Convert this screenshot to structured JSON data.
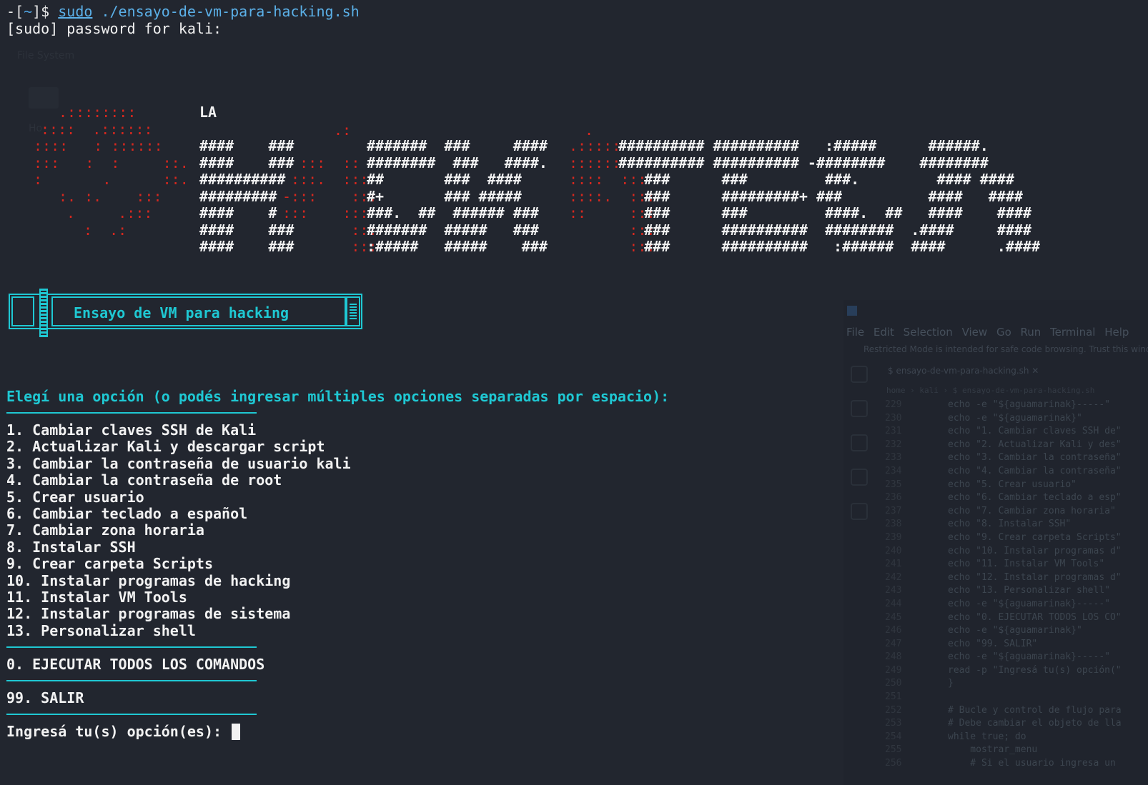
{
  "terminal": {
    "prompt_prefix": "-[",
    "prompt_dir": "~",
    "prompt_suffix": "]$ ",
    "command": "sudo",
    "argument": " ./ensayo-de-vm-para-hacking.sh",
    "sudo_line": "[sudo] password for kali:"
  },
  "banner": {
    "la": "LA",
    "dots_top": ".:",
    "dot_single": ".",
    "skull_lines": [
      ".::::::::",
      "::::  .::::::",
      "::::   : ::::::",
      ":::   :  :     ::.",
      ":       .      ::.",
      ":. :.    :::",
      ".     .:::",
      ":  .:"
    ],
    "white_col1": [
      "####    ###",
      "####    ###",
      "##########",
      "#########",
      "####    #",
      "####    ###",
      "####    ###"
    ],
    "red_col1": [
      "",
      "  :::  ::",
      " :::.  :::",
      "-:::    :::",
      ":::    :::",
      "        :::",
      "        :::"
    ],
    "mid_1": [
      "#######  ###     ####",
      "########  ###   ####.",
      "##       ###  ####",
      "#+       ### #####",
      "###.  ##  ###### ###",
      "#######  #####   ###",
      ":#####   #####    ###"
    ],
    "red_col2": [
      ".:::::",
      "::::::",
      "::::  :::",
      "::::.  :::",
      "::     :::",
      "       :::",
      "       :::"
    ],
    "right_1": [
      "########## ##########   :#####      ######.",
      "########## ########## -########    ########",
      "   ###      ###         ###.         #### ####",
      "   ###      #########+ ###          ####   ####",
      "   ###      ###         ####.  ##   ####    ####",
      "   ###      ##########  ########  .####     ####",
      "   ###      ##########   :######  ####      .####"
    ]
  },
  "title_box": {
    "label": "Ensayo de VM para hacking"
  },
  "menu": {
    "heading": "Elegí una opción (o podés ingresar múltiples opciones separadas por espacio):",
    "items": [
      "1. Cambiar claves SSH de Kali",
      "2. Actualizar Kali y descargar script",
      "3. Cambiar la contraseña de usuario kali",
      "4. Cambiar la contraseña de root",
      "5. Crear usuario",
      "6. Cambiar teclado a español",
      "7. Cambiar zona horaria",
      "8. Instalar SSH",
      "9. Crear carpeta Scripts",
      "10. Instalar programas de hacking",
      "11. Instalar VM Tools",
      "12. Instalar programas de sistema",
      "13. Personalizar shell"
    ],
    "run_all": "0. EJECUTAR TODOS LOS COMANDOS",
    "exit": "99. SALIR",
    "input_prompt": "Ingresá tu(s) opción(es): "
  },
  "background_window": {
    "faint_label": "File System",
    "faint_home_label": "Ho",
    "menubar": "File Edit Selection View Go Run Terminal Help",
    "notice": "Restricted Mode is intended for safe code browsing. Trust this window",
    "tab": "$ ensayo-de-vm-para-hacking.sh  ✕",
    "breadcrumb": "home › kali › $ ensayo-de-vm-para-hacking.sh",
    "code_lines": [
      {
        "n": "229",
        "t": "echo -e \"${aguamarinak}-----\""
      },
      {
        "n": "230",
        "t": "echo -e \"${aguamarinak}\""
      },
      {
        "n": "231",
        "t": "echo \"1. Cambiar claves SSH de\""
      },
      {
        "n": "232",
        "t": "echo \"2. Actualizar Kali y des\""
      },
      {
        "n": "233",
        "t": "echo \"3. Cambiar la contraseña\""
      },
      {
        "n": "234",
        "t": "echo \"4. Cambiar la contraseña\""
      },
      {
        "n": "235",
        "t": "echo \"5. Crear usuario\""
      },
      {
        "n": "236",
        "t": "echo \"6. Cambiar teclado a esp\""
      },
      {
        "n": "237",
        "t": "echo \"7. Cambiar zona horaria\""
      },
      {
        "n": "238",
        "t": "echo \"8. Instalar SSH\""
      },
      {
        "n": "239",
        "t": "echo \"9. Crear carpeta Scripts\""
      },
      {
        "n": "240",
        "t": "echo \"10. Instalar programas d\""
      },
      {
        "n": "241",
        "t": "echo \"11. Instalar VM Tools\""
      },
      {
        "n": "242",
        "t": "echo \"12. Instalar programas d\""
      },
      {
        "n": "243",
        "t": "echo \"13. Personalizar shell\""
      },
      {
        "n": "244",
        "t": "echo -e \"${aguamarinak}-----\""
      },
      {
        "n": "245",
        "t": "echo \"0. EJECUTAR TODOS LOS CO\""
      },
      {
        "n": "246",
        "t": "echo -e \"${aguamarinak}\""
      },
      {
        "n": "247",
        "t": "echo \"99. SALIR\""
      },
      {
        "n": "248",
        "t": "echo -e \"${aguamarinak}-----\""
      },
      {
        "n": "249",
        "t": "read -p \"Ingresá tu(s) opción(\""
      },
      {
        "n": "250",
        "t": "}"
      },
      {
        "n": "251",
        "t": ""
      },
      {
        "n": "252",
        "t": "# Bucle y control de flujo para"
      },
      {
        "n": "253",
        "t": "# Debe cambiar el objeto de lla"
      },
      {
        "n": "254",
        "t": "while true; do"
      },
      {
        "n": "255",
        "t": "    mostrar_menu"
      },
      {
        "n": "256",
        "t": "    # Si el usuario ingresa un"
      }
    ]
  },
  "colors": {
    "background": "#22262f",
    "accent_cyan": "#1fc8d3",
    "banner_red": "#d5281f",
    "prompt_blue": "#5bb0e8"
  }
}
